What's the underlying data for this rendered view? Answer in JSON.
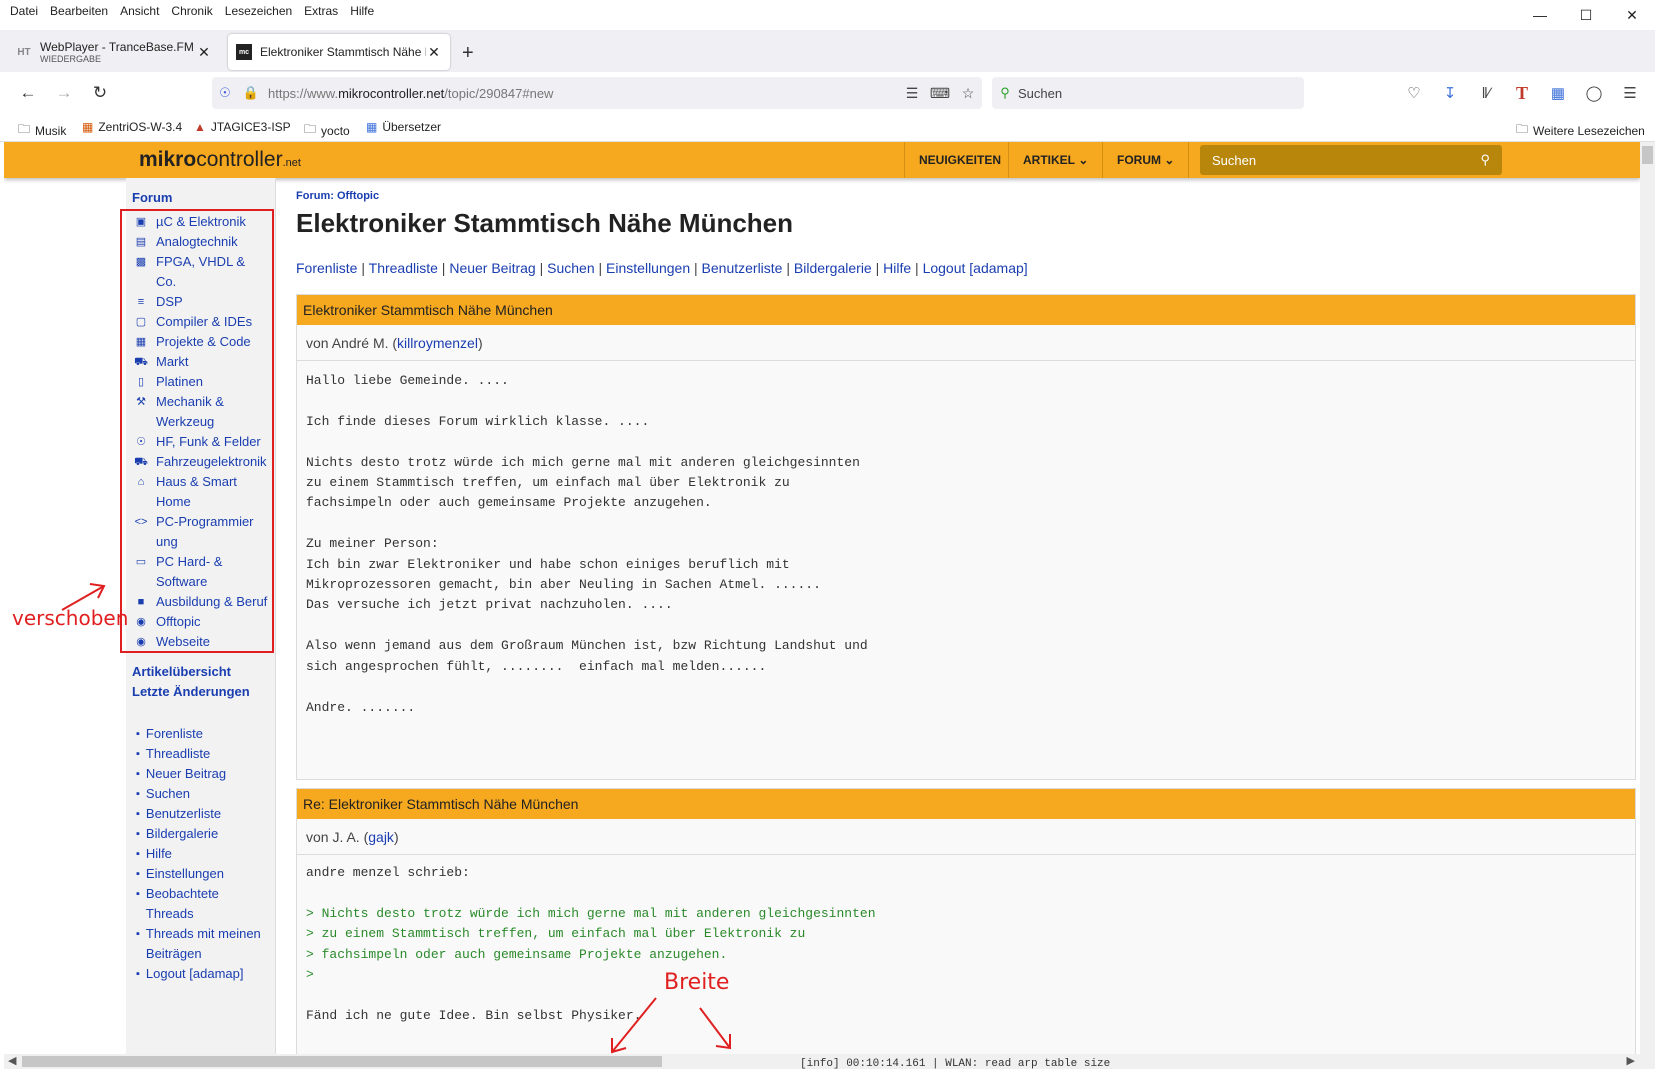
{
  "menubar": [
    "Datei",
    "Bearbeiten",
    "Ansicht",
    "Chronik",
    "Lesezeichen",
    "Extras",
    "Hilfe"
  ],
  "tabs": [
    {
      "title": "WebPlayer - TranceBase.FM - W",
      "subtitle": "WIEDERGABE",
      "favicon": "HT"
    },
    {
      "title": "Elektroniker Stammtisch Nähe M",
      "favicon": "mc"
    }
  ],
  "url": {
    "prefix": "https://www.",
    "domain": "mikrocontroller.net",
    "path": "/topic/290847#new"
  },
  "browser_search": {
    "placeholder": "Suchen"
  },
  "bookmarks": [
    {
      "label": "Musik",
      "icon": "folder-icon"
    },
    {
      "label": "ZentriOS-W-3.4",
      "icon": "doc-icon"
    },
    {
      "label": "JTAGICE3-ISP",
      "icon": "microchip-icon"
    },
    {
      "label": "yocto",
      "icon": "folder-icon"
    },
    {
      "label": "Übersetzer",
      "icon": "translate-icon"
    },
    {
      "label": "Weitere Lesezeichen",
      "icon": "folder-icon"
    }
  ],
  "site": {
    "logo_main": "mikro",
    "logo_rest": "controller",
    "logo_tld": ".net",
    "nav": [
      "NEUIGKEITEN",
      "ARTIKEL",
      "FORUM"
    ],
    "search_placeholder": "Suchen"
  },
  "sidebar": {
    "title": "Forum",
    "forums": [
      {
        "label": "µC & Elektronik",
        "icon": "chip-icon"
      },
      {
        "label": "Analogtechnik",
        "icon": "board-icon"
      },
      {
        "label": "FPGA, VHDL & Co.",
        "icon": "fpga-icon"
      },
      {
        "label": "DSP",
        "icon": "wave-icon"
      },
      {
        "label": "Compiler & IDEs",
        "icon": "monitor-icon"
      },
      {
        "label": "Projekte & Code",
        "icon": "code-icon"
      },
      {
        "label": "Markt",
        "icon": "cart-icon"
      },
      {
        "label": "Platinen",
        "icon": "pcb-icon"
      },
      {
        "label": "Mechanik & Werkzeug",
        "icon": "wrench-icon"
      },
      {
        "label": "HF, Funk & Felder",
        "icon": "antenna-icon"
      },
      {
        "label": "Fahrzeugelektronik",
        "icon": "car-icon"
      },
      {
        "label": "Haus & Smart Home",
        "icon": "home-icon"
      },
      {
        "label": "PC-Programmierung",
        "icon": "brackets-icon"
      },
      {
        "label": "PC Hard- & Software",
        "icon": "laptop-icon"
      },
      {
        "label": "Ausbildung & Beruf",
        "icon": "book-icon"
      },
      {
        "label": "Offtopic",
        "icon": "chat-icon"
      },
      {
        "label": "Webseite",
        "icon": "globe-icon"
      }
    ],
    "main_links": [
      "Artikelübersicht",
      "Letzte Änderungen"
    ],
    "bullet_links": [
      "Forenliste",
      "Threadliste",
      "Neuer Beitrag",
      "Suchen",
      "Benutzerliste",
      "Bildergalerie",
      "Hilfe",
      "Einstellungen",
      "Beobachtete Threads",
      "Threads mit meinen Beiträgen",
      "Logout [adamap]"
    ]
  },
  "main": {
    "breadcrumb": "Forum: Offtopic",
    "title": "Elektroniker Stammtisch Nähe München",
    "links": [
      "Forenliste",
      "Threadliste",
      "Neuer Beitrag",
      "Suchen",
      "Einstellungen",
      "Benutzerliste",
      "Bildergalerie",
      "Hilfe",
      "Logout [adamap]"
    ],
    "posts": [
      {
        "subject": "Elektroniker Stammtisch Nähe München",
        "by_prefix": "von André M. (",
        "username": "killroymenzel",
        "by_suffix": ")",
        "body": "Hallo liebe Gemeinde. ....\n\nIch finde dieses Forum wirklich klasse. ....\n\nNichts desto trotz würde ich mich gerne mal mit anderen gleichgesinnten\nzu einem Stammtisch treffen, um einfach mal über Elektronik zu\nfachsimpeln oder auch gemeinsame Projekte anzugehen.\n\nZu meiner Person:\nIch bin zwar Elektroniker und habe schon einiges beruflich mit\nMikroprozessoren gemacht, bin aber Neuling in Sachen Atmel. ......\nDas versuche ich jetzt privat nachzuholen. ....\n\nAlso wenn jemand aus dem Großraum München ist, bzw Richtung Landshut und\nsich angesprochen fühlt, ........  einfach mal melden......\n\nAndre. ......."
      },
      {
        "subject": "Re: Elektroniker Stammtisch Nähe München",
        "by_prefix": "von J. A. (",
        "username": "gajk",
        "by_suffix": ")",
        "intro": "andre menzel schrieb:\n",
        "quote": "> Nichts desto trotz würde ich mich gerne mal mit anderen gleichgesinnten\n> zu einem Stammtisch treffen, um einfach mal über Elektronik zu\n> fachsimpeln oder auch gemeinsame Projekte anzugehen.\n>",
        "reply": "\nFänd ich ne gute Idee. Bin selbst Physiker."
      }
    ]
  },
  "annotations": {
    "left": "verschoben",
    "bottom": "Breite"
  },
  "background_text": "[info] 00:10:14.161 | WLAN: read arp table size",
  "colors": {
    "accent": "#f6a81f",
    "link": "#1a3eb0",
    "annotation": "#e02020",
    "quote": "#2a8a2a"
  }
}
